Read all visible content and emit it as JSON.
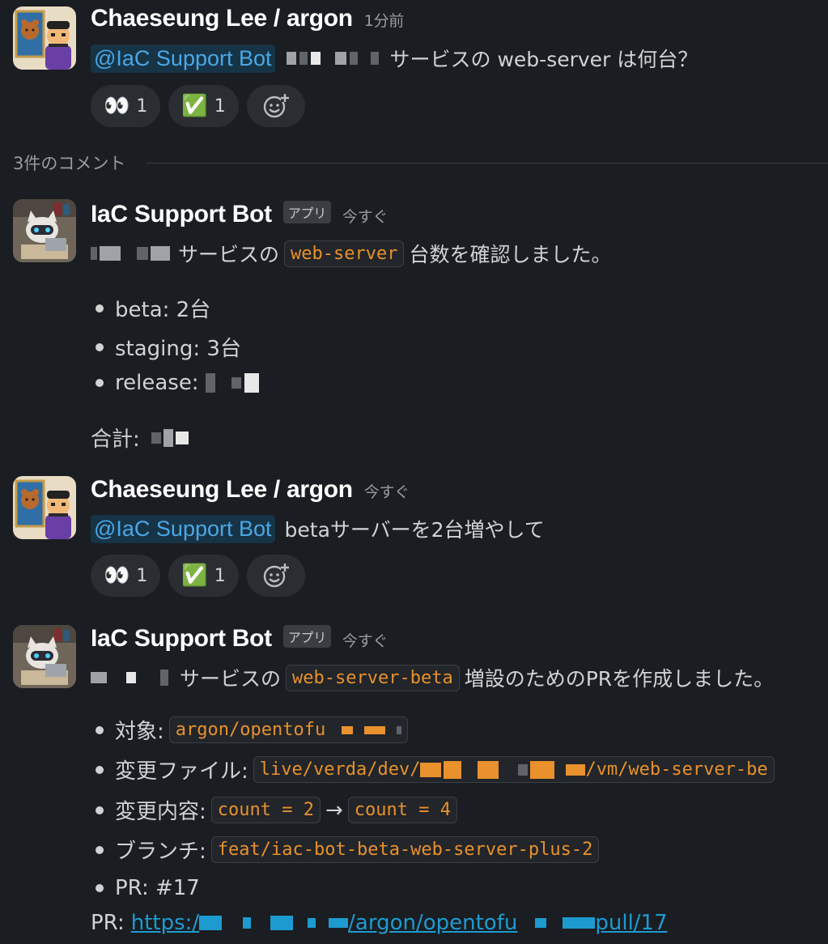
{
  "messages": [
    {
      "author": "Chaeseung Lee / argon",
      "timestamp": "1分前",
      "mention": "@IaC Support Bot",
      "text_suffix": "サービスの web-server は何台？",
      "reactions": [
        {
          "emoji": "👀",
          "count": "1"
        },
        {
          "emoji": "✅",
          "count": "1"
        }
      ]
    },
    {
      "author": "IaC Support Bot",
      "badge": "アプリ",
      "timestamp": "今すぐ",
      "line1_suffix": "サービスの",
      "line1_code": "web-server",
      "line1_tail": "台数を確認しました。",
      "bullets": [
        "beta: 2台",
        "staging: 3台",
        "release:"
      ],
      "total_label": "合計:"
    },
    {
      "author": "Chaeseung Lee / argon",
      "timestamp": "今すぐ",
      "mention": "@IaC Support Bot",
      "text_suffix": "betaサーバーを2台増やして",
      "reactions": [
        {
          "emoji": "👀",
          "count": "1"
        },
        {
          "emoji": "✅",
          "count": "1"
        }
      ]
    },
    {
      "author": "IaC Support Bot",
      "badge": "アプリ",
      "timestamp": "今すぐ",
      "line1_suffix": "サービスの",
      "line1_code": "web-server-beta",
      "line1_tail": "増設のためのPRを作成しました。",
      "bullets": [
        {
          "label": "対象:",
          "code": "argon/opentofu"
        },
        {
          "label": "変更ファイル:",
          "code": "live/verda/dev/",
          "code_tail": "/vm/web-server-be"
        },
        {
          "label": "変更内容:",
          "code_a": "count = 2",
          "arrow": "→",
          "code_b": "count = 4"
        },
        {
          "label": "ブランチ:",
          "code": "feat/iac-bot-beta-web-server-plus-2"
        },
        {
          "label": "PR: #17"
        }
      ],
      "pr_label": "PR:",
      "pr_link_a": "https:/",
      "pr_link_b": "/argon/opentofu",
      "pr_link_c": "pull/17"
    }
  ],
  "thread_divider": "3件のコメント",
  "colors": {
    "background": "#1a1d21",
    "mention": "#4aa7e4",
    "code": "#e8912d",
    "link": "#1d9bd1"
  },
  "icons": {
    "add_reaction": "add-reaction-icon"
  }
}
